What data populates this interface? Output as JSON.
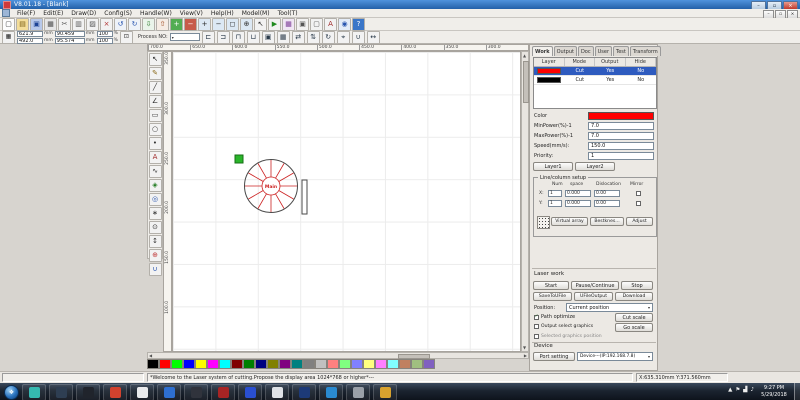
{
  "ui": {
    "caret": "▾",
    "check": "✓",
    "arrow_left": "◀",
    "arrow_right": "▶",
    "arrow_up": "▲",
    "arrow_down": "▼"
  },
  "window": {
    "title": "V8.01.18 - [Blank]",
    "minimize": "–",
    "maximize": "▫",
    "close": "×"
  },
  "menu": {
    "items": [
      "File(F)",
      "Edit(E)",
      "Draw(D)",
      "Config(S)",
      "Handle(W)",
      "View(V)",
      "Help(H)",
      "Model(M)",
      "Tool(T)"
    ]
  },
  "toolbar_main": {
    "icons": [
      {
        "name": "new-file-icon",
        "glyph": "▢",
        "fg": "#3a3a3a",
        "bg": "#fdfdfd"
      },
      {
        "name": "open-file-icon",
        "glyph": "▤",
        "fg": "#7a5c10",
        "bg": "#f3dd9a"
      },
      {
        "name": "save-file-icon",
        "glyph": "▣",
        "fg": "#1e4496",
        "bg": "#b7c8ea"
      },
      {
        "name": "print-icon",
        "glyph": "▦",
        "fg": "#4a4a4a",
        "bg": "#e6e6e6"
      },
      {
        "name": "cut-icon",
        "glyph": "✂",
        "fg": "#555555",
        "bg": "#f2f2f2"
      },
      {
        "name": "copy-icon",
        "glyph": "▥",
        "fg": "#555555",
        "bg": "#f2f2f2"
      },
      {
        "name": "paste-icon",
        "glyph": "▨",
        "fg": "#555555",
        "bg": "#f2f2f2"
      },
      {
        "name": "delete-icon",
        "glyph": "×",
        "fg": "#b03030",
        "bg": "#f2f2f2"
      },
      {
        "name": "undo-icon",
        "glyph": "↺",
        "fg": "#2a56b0",
        "bg": "#eef2f8"
      },
      {
        "name": "redo-icon",
        "glyph": "↻",
        "fg": "#2a56b0",
        "bg": "#eef2f8"
      },
      {
        "name": "import-icon",
        "glyph": "⇩",
        "fg": "#2a7a2a",
        "bg": "#eaf4ea"
      },
      {
        "name": "export-icon",
        "glyph": "⇧",
        "fg": "#a04a20",
        "bg": "#f6ece4"
      },
      {
        "name": "add-device-icon",
        "glyph": "+",
        "fg": "#ffffff",
        "bg": "#52ad52"
      },
      {
        "name": "remove-device-icon",
        "glyph": "−",
        "fg": "#ffffff",
        "bg": "#c75b4a"
      },
      {
        "name": "zoom-in-icon",
        "glyph": "+",
        "fg": "#2a2a2a",
        "bg": "#dce8f4"
      },
      {
        "name": "zoom-out-icon",
        "glyph": "−",
        "fg": "#2a2a2a",
        "bg": "#dce8f4"
      },
      {
        "name": "zoom-window-icon",
        "glyph": "◻",
        "fg": "#2a2a2a",
        "bg": "#dce8f4"
      },
      {
        "name": "pan-view-icon",
        "glyph": "⊕",
        "fg": "#2a2a2a",
        "bg": "#dce8f4"
      },
      {
        "name": "select-all-icon",
        "glyph": "↖",
        "fg": "#2a2a2a",
        "bg": "#f2f2f2"
      },
      {
        "name": "simulate-icon",
        "glyph": "▶",
        "fg": "#1f8a1f",
        "bg": "#f2f2f2"
      },
      {
        "name": "array-copy-icon",
        "glyph": "▦",
        "fg": "#7a3a96",
        "bg": "#f0e6f4"
      },
      {
        "name": "group-icon",
        "glyph": "▣",
        "fg": "#555555",
        "bg": "#f2f2f2"
      },
      {
        "name": "ungroup-icon",
        "glyph": "▢",
        "fg": "#555555",
        "bg": "#f2f2f2"
      },
      {
        "name": "text-icon",
        "glyph": "A",
        "fg": "#a02a2a",
        "bg": "#f2f2f2"
      },
      {
        "name": "preview-icon",
        "glyph": "◉",
        "fg": "#2a56b0",
        "bg": "#e4ecf8"
      },
      {
        "name": "help-icon",
        "glyph": "?",
        "fg": "#ffffff",
        "bg": "#3a76c8"
      }
    ]
  },
  "toolbar_edit": {
    "anchor_icon": "▦",
    "lock_icon": "⊡",
    "x_value": "621.9",
    "y_value": "492.0",
    "unit": "mm",
    "w_value": "90.459",
    "h_value": "95.574",
    "sx_value": "100",
    "sy_value": "100",
    "pct": "%",
    "process_label": "Process NO:",
    "icons": [
      {
        "name": "align-left-icon",
        "glyph": "⊏"
      },
      {
        "name": "align-right-icon",
        "glyph": "⊐"
      },
      {
        "name": "align-top-icon",
        "glyph": "⊓"
      },
      {
        "name": "align-bottom-icon",
        "glyph": "⊔"
      },
      {
        "name": "align-center-icon",
        "glyph": "▣"
      },
      {
        "name": "same-size-icon",
        "glyph": "▦"
      },
      {
        "name": "mirror-horizontal-icon",
        "glyph": "⇄"
      },
      {
        "name": "mirror-vertical-icon",
        "glyph": "⇅"
      },
      {
        "name": "rotate-icon",
        "glyph": "↻"
      },
      {
        "name": "nudge-icon",
        "glyph": "⌖"
      },
      {
        "name": "weld-icon",
        "glyph": "∪"
      },
      {
        "name": "measure-icon",
        "glyph": "↔"
      }
    ]
  },
  "left_toolbar": {
    "icons": [
      {
        "name": "select-tool-icon",
        "glyph": "↖",
        "fg": "#222222"
      },
      {
        "name": "node-edit-icon",
        "glyph": "✎",
        "fg": "#8a6a1a"
      },
      {
        "name": "line-tool-icon",
        "glyph": "╱",
        "fg": "#333333"
      },
      {
        "name": "polyline-tool-icon",
        "glyph": "∠",
        "fg": "#333333"
      },
      {
        "name": "rectangle-tool-icon",
        "glyph": "▭",
        "fg": "#333333"
      },
      {
        "name": "ellipse-tool-icon",
        "glyph": "○",
        "fg": "#333333"
      },
      {
        "name": "point-tool-icon",
        "glyph": "•",
        "fg": "#333333"
      },
      {
        "name": "text-tool-icon",
        "glyph": "A",
        "fg": "#a02a2a"
      },
      {
        "name": "bezier-tool-icon",
        "glyph": "∿",
        "fg": "#333333"
      },
      {
        "name": "capture-tool-icon",
        "glyph": "◈",
        "fg": "#1f7a1f"
      },
      {
        "name": "offset-tool-icon",
        "glyph": "◎",
        "fg": "#2a56b0"
      },
      {
        "name": "move-tool-icon",
        "glyph": "∗",
        "fg": "#333333"
      },
      {
        "name": "zoom-tool-icon",
        "glyph": "⊙",
        "fg": "#333333"
      },
      {
        "name": "measure-tool-icon",
        "glyph": "↕",
        "fg": "#333333"
      },
      {
        "name": "laser-head-position-icon",
        "glyph": "⊕",
        "fg": "#c03a3a"
      },
      {
        "name": "weld-tool-icon",
        "glyph": "∪",
        "fg": "#2a56b0"
      }
    ]
  },
  "rulers": {
    "top": [
      "700.0",
      "650.0",
      "600.0",
      "550.0",
      "500.0",
      "450.0",
      "400.0",
      "350.0",
      "300.0"
    ],
    "left": [
      "350.0",
      "300.0",
      "250.0",
      "200.0",
      "150.0",
      "100.0"
    ]
  },
  "canvas": {
    "object_label": "Main"
  },
  "right_panel": {
    "tabs": [
      {
        "label": "Work",
        "active": true
      },
      {
        "label": "Output"
      },
      {
        "label": "Doc"
      },
      {
        "label": "User"
      },
      {
        "label": "Test"
      },
      {
        "label": "Transform"
      }
    ],
    "layer_table": {
      "headers": [
        "Layer",
        "Mode",
        "Output",
        "Hide"
      ],
      "rows": [
        {
          "color": "#ff0000",
          "mode": "Cut",
          "output": "Yes",
          "hide": "No",
          "selected": true
        },
        {
          "color": "#000000",
          "mode": "Cut",
          "output": "Yes",
          "hide": "No",
          "selected": false
        }
      ]
    },
    "color_label": "Color",
    "color_value": "#ff0000",
    "params": [
      {
        "label": "MinPower(%)-1",
        "value": "7.0"
      },
      {
        "label": "MaxPower(%)-1",
        "value": "7.0"
      },
      {
        "label": "Speed(mm/s):",
        "value": "150.0"
      },
      {
        "label": "Priority:",
        "value": "1"
      }
    ],
    "layer_buttons": [
      "Layer1",
      "Layer2"
    ],
    "line_column": {
      "title": "Line/column setup",
      "headers": [
        "Num",
        "space",
        "Dislocation",
        "Mirror"
      ],
      "x_label": "X:",
      "x_num": "1",
      "x_space": "0.000",
      "x_dislocation": "0.00",
      "y_label": "Y:",
      "y_num": "1",
      "y_space": "0.000",
      "y_dislocation": "0.00",
      "buttons": [
        "Virtual array",
        "Bestknes...",
        "Adjust"
      ]
    },
    "laser_work": {
      "title": "Laser work",
      "buttons_row1": [
        "Start",
        "Pause/Continue",
        "Stop"
      ],
      "buttons_row2": [
        "SaveToUFile",
        "UFileOutput",
        "Download"
      ],
      "position_label": "Position:",
      "position_value": "Current position",
      "checks": [
        {
          "label": "Path optimize",
          "checked": true
        },
        {
          "label": "Output select graphics",
          "checked": false
        },
        {
          "label": "Selected graphics position",
          "checked": false
        }
      ],
      "scale_buttons": [
        "Cut scale",
        "Go scale"
      ]
    },
    "device": {
      "title": "Device",
      "port_button": "Port setting",
      "device_value": "Device---(IP:192.168.7.8)"
    }
  },
  "palette": {
    "colors": [
      "#000000",
      "#ff0000",
      "#00ff00",
      "#0000ff",
      "#ffff00",
      "#ff00ff",
      "#00ffff",
      "#800000",
      "#008000",
      "#000080",
      "#808000",
      "#800080",
      "#008080",
      "#808080",
      "#c0c0c0",
      "#ff8080",
      "#80ff80",
      "#8080ff",
      "#ffff80",
      "#ff80ff",
      "#80ffff",
      "#c08060",
      "#a0c080",
      "#8060c0"
    ]
  },
  "status_bar": {
    "message": "*Welcome to the Laser system of cutting.Propose the display area 1024*768 or higher*---",
    "coords": "X:635.310mm Y:371.560mm"
  },
  "taskbar": {
    "start_glyph": "❖",
    "apps": [
      {
        "color": "#35b8b0"
      },
      {
        "color": "#2e3e52"
      },
      {
        "color": "#20242c"
      },
      {
        "color": "#d2422e"
      },
      {
        "color": "#e9eaec"
      },
      {
        "color": "#2e6fd0"
      },
      {
        "color": "#30333c"
      },
      {
        "color": "#a82424"
      },
      {
        "color": "#2a4fd0"
      },
      {
        "color": "#dfe2e6"
      },
      {
        "color": "#1d3a78"
      },
      {
        "color": "#2a8ad0"
      },
      {
        "color": "#9aa0a8"
      },
      {
        "color": "#d8a22e"
      }
    ],
    "tray": [
      {
        "name": "show-hidden-icons-icon",
        "glyph": "▲"
      },
      {
        "name": "action-center-icon",
        "glyph": "⚑"
      },
      {
        "name": "network-icon",
        "glyph": "▟"
      },
      {
        "name": "volume-icon",
        "glyph": "♪"
      }
    ],
    "time": "9:27 PM",
    "date": "5/29/2018"
  }
}
